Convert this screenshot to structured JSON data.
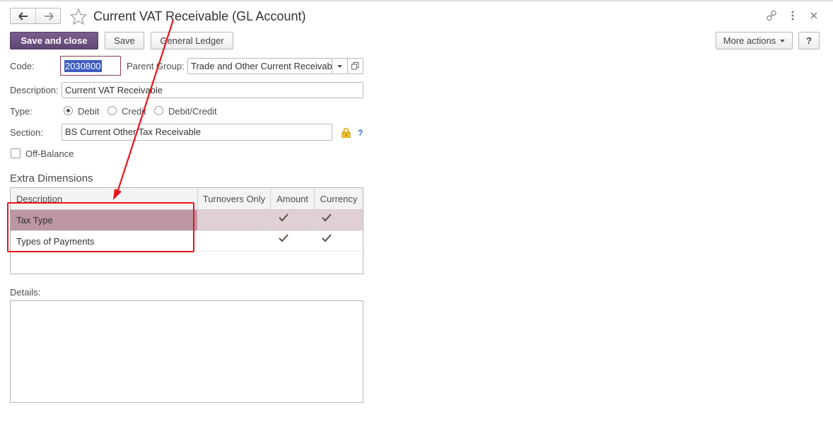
{
  "window": {
    "title": "Current VAT Receivable (GL Account)"
  },
  "toolbar": {
    "save_close": "Save and close",
    "save": "Save",
    "general_ledger": "General Ledger",
    "more_actions": "More actions",
    "help": "?"
  },
  "form": {
    "code_label": "Code:",
    "code_value": "2030800",
    "parent_group_label": "Parent Group:",
    "parent_group_value": "Trade and Other Current Receivabl",
    "description_label": "Description:",
    "description_value": "Current VAT Receivable",
    "type_label": "Type:",
    "type_options": [
      "Debit",
      "Credit",
      "Debit/Credit"
    ],
    "type_selected": "Debit",
    "section_label": "Section:",
    "section_value": "BS Current Other Tax Receivable",
    "section_help": "?",
    "off_balance_label": "Off-Balance",
    "off_balance_checked": false
  },
  "extra_dimensions": {
    "title": "Extra Dimensions",
    "columns": [
      "Description",
      "Turnovers Only",
      "Amount",
      "Currency"
    ],
    "rows": [
      {
        "description": "Tax Type",
        "turnovers_only": false,
        "amount": true,
        "currency": true,
        "selected": true
      },
      {
        "description": "Types of Payments",
        "turnovers_only": false,
        "amount": true,
        "currency": true,
        "selected": false
      }
    ]
  },
  "details": {
    "label": "Details:",
    "value": ""
  },
  "colors": {
    "primary_button": "#6a5080",
    "selected_row_desc": "#bc96a2",
    "selected_row_other": "#e0cfd5",
    "annotation_red": "#e8141b",
    "lock_icon": "#e0a800",
    "help_link": "#2a6fc9"
  }
}
